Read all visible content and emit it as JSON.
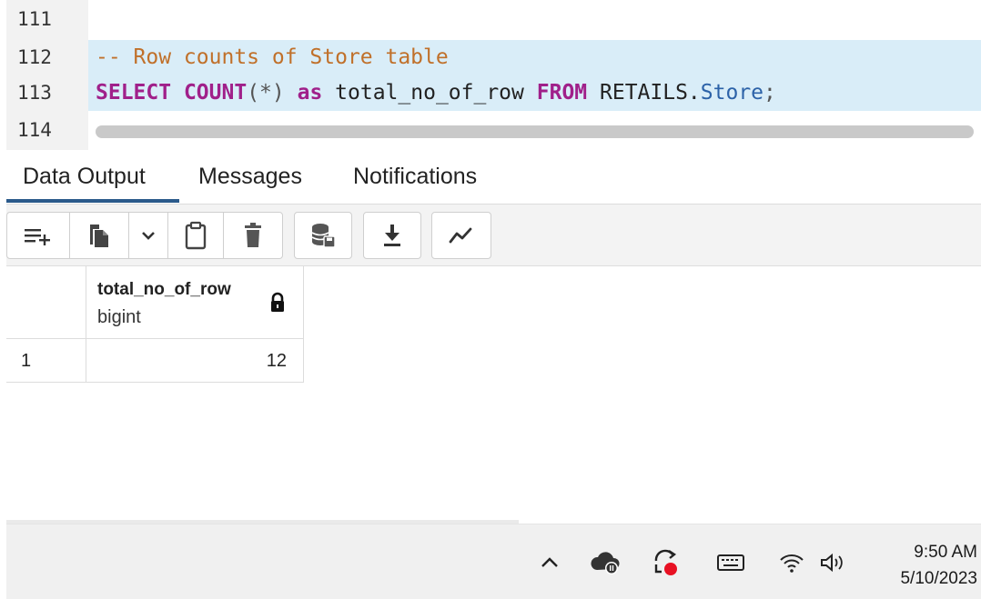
{
  "editor": {
    "lines": [
      {
        "number": "111",
        "text": ""
      },
      {
        "number": "112",
        "text": "-- Row counts of Store table"
      },
      {
        "number": "113",
        "text": "SELECT COUNT(*) as total_no_of_row FROM RETAILS.Store;"
      },
      {
        "number": "114",
        "text": ""
      }
    ],
    "tokens": {
      "comment": "-- Row counts of Store table",
      "select": "SELECT",
      "count": "COUNT",
      "paren": "(*)",
      "as": "as",
      "alias": "total_no_of_row",
      "from": "FROM",
      "schema": "RETAILS.",
      "table": "Store",
      "semicolon": ";"
    }
  },
  "tabs": [
    {
      "label": "Data Output",
      "active": true
    },
    {
      "label": "Messages",
      "active": false
    },
    {
      "label": "Notifications",
      "active": false
    }
  ],
  "toolbar": {
    "icons": [
      "add-row-icon",
      "copy-icon",
      "chevron-down-icon",
      "paste-icon",
      "delete-icon",
      "save-data-icon",
      "download-icon",
      "graph-icon"
    ]
  },
  "grid": {
    "columns": [
      {
        "name": "total_no_of_row",
        "type": "bigint",
        "locked": true
      }
    ],
    "rows": [
      {
        "index": "1",
        "values": [
          "12"
        ]
      }
    ]
  },
  "taskbar": {
    "icons": [
      "chevron-up-icon",
      "onedrive-icon",
      "sync-icon",
      "keyboard-icon",
      "wifi-icon",
      "volume-icon"
    ],
    "time": "9:50 AM",
    "date": "5/10/2023"
  },
  "colors": {
    "highlight": "#d9edf8",
    "comment": "#c0702a",
    "keyword": "#a0208a",
    "property": "#2c62a8",
    "active_tab": "#2b5a8b"
  }
}
